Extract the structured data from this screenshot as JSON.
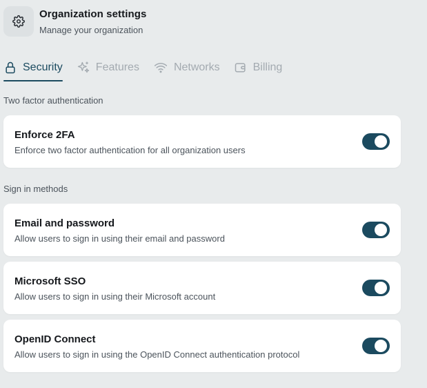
{
  "header": {
    "title": "Organization settings",
    "subtitle": "Manage your organization",
    "icon": "gear-icon"
  },
  "tabs": [
    {
      "label": "Security",
      "icon": "lock-icon",
      "active": true
    },
    {
      "label": "Features",
      "icon": "sparkles-icon",
      "active": false
    },
    {
      "label": "Networks",
      "icon": "wifi-icon",
      "active": false
    },
    {
      "label": "Billing",
      "icon": "wallet-icon",
      "active": false
    }
  ],
  "sections": {
    "two_factor": {
      "label": "Two factor authentication",
      "items": [
        {
          "title": "Enforce 2FA",
          "description": "Enforce two factor authentication for all organization users",
          "enabled": true
        }
      ]
    },
    "sign_in": {
      "label": "Sign in methods",
      "items": [
        {
          "title": "Email and password",
          "description": "Allow users to sign in using their email and password",
          "enabled": true
        },
        {
          "title": "Microsoft SSO",
          "description": "Allow users to sign in using their Microsoft account",
          "enabled": true
        },
        {
          "title": "OpenID Connect",
          "description": "Allow users to sign in using the OpenID Connect authentication protocol",
          "enabled": true
        }
      ]
    }
  },
  "colors": {
    "accent": "#1b4a5f",
    "background": "#e8ebec",
    "card": "#ffffff",
    "muted_tab": "#a3aab0"
  }
}
